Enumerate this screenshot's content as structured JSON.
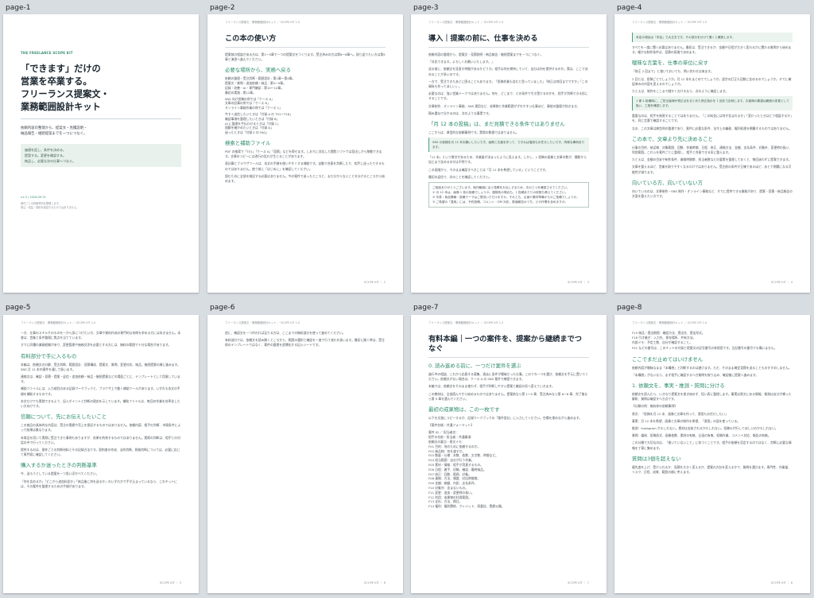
{
  "pages": {
    "p1": {
      "label": "page-1",
      "kit": "THE FREELANCE SCOPE KIT",
      "title": [
        "「できます」だけの",
        "営業を卒業する。",
        "フリーランス提案文・",
        "業務範囲設計キット"
      ],
      "subtitle": [
        "依頼内容の整理から、提案文・見積説明・",
        "納品報告・継続提案までを一つにつなぐ。"
      ],
      "box": [
        "価値を話し、条件を決める。",
        "提案する。変更を確認する。",
        "納品し、必要な次の仕事へつなぐ。"
      ],
      "version": "v1.0 | 2026.09.21",
      "notes": [
        "案件ごとの判断材料を整理します。",
        "受注・収益・契約を保証するものではありません。"
      ]
    },
    "p2": {
      "label": "page-2",
      "header": "フリーランス提案文・業務範囲設計キット ／ SCOPE KIT 1.0",
      "title": "この本の使い方",
      "intro": "提案前の相談がある方は、第1〜5章で一つの提案文をつくります。受注済みの方は第6〜8章へ。振り返りたい方は第9章と演習へ進んでください。",
      "s1": "必要な場所から、実務へ戻る",
      "list": [
        "依頼の整理・受注判断・範囲設計 : 第1章〜第4章。",
        "提案文・質問・追加依頼・納品 : 第5〜9章。",
        "記録・改善・AI・専門確認 : 第10〜12章。",
        "最初の実践 : 第12章。"
      ],
      "para1": "SNS 向け投稿の例では「ケース A」",
      "para2": "文章の記事の例では「ケース B」",
      "para3": "オンライン事務作業の例では「ケース C」",
      "para4": "今すぐ送信したいときは「付録 A の T01〜T18」",
      "para5": "確認事項を整理したいときは「付録 B」",
      "para6": "AI に整理を手伝わせるときは「付録 C」",
      "para7": "理解を確かめたいときは「付録 D」",
      "para8": "迷ったときは「付録 E の FAQ」",
      "s2": "検索と補助ファイル",
      "para9": "PDF の検索で「T01」「ケース A」「見積」などを探せます。しおりに対応した閲覧ソフトでは見出しから移動できます。文章のコピーには改行の乱れが生じることがあります。",
      "para10": "表計算とブラウザツールは、本文の手順を使いやすくする補助です。自動で合意を判断したり、相手に送ったりするものではありません。使う前に「はじめに」を確認してください。",
      "para11": "読むために全部を暗記する必要はありません。今の案件で迷ったところと、まだ分からないことを分けるところから始めます。",
      "footer": "SCOPE KIT ｜ 2"
    },
    "p3": {
      "label": "page-3",
      "header": "フリーランス提案文・業務範囲設計キット ／ SCOPE KIT 1.0",
      "title": "導入｜提案の前に、仕事を決める",
      "p1": "依頼内容の整理から、提案文・見積説明・納品報告・継続提案までを一つにつなぐ。",
      "p2": "「対応できます。よろしくお願いいたします。」",
      "p3": "送る前に、依頼文を見直す時間があるかどうか。相手は何を期待していて、自分は何を提供するのか。実は、ここで決めることが多いのです。",
      "p4": "一方で、受注できたあとに困ることもあります。「投稿作業も含むと思っていました」「修正は何回までですか」「この資料も作ってほしい」。",
      "p5": "必要なのは、強い営業トークではありません。何を、どこまで、どの条件で引き受けるのかを、相手が判断できる形にすることです。",
      "p6": "文章制作、オンライン事務、SNS 運用など、成果物と作業範囲がずれやすい仕事ほど、事前の整理が効きます。",
      "p7": "積み重ねで分かるのは、次のような事実です。",
      "s1": "「月 12 本の投稿」は、まだ見積できる条件ではありません",
      "p8": "ここからは、典型的な依頼事例です。実際の数値ではありません。",
      "callout": "SNS の投稿を月 12 本お願いしたいです。画像と文章を作って、できれば運用もお任せしたいです。同様な事例あります。",
      "p9": "「12 本」という数字があるため、作業量が決まったように見えます。しかし、1 投稿の画像と文章の数が、撮影から加工まで含めるのかは不明です。",
      "p10": "この段階から、そのまま確認すべきことは「月 12 本を希望している」ということです。",
      "p11": "最初の返信で、次のことを確認してください。",
      "box": [
        "ご相談ありがとうございます。制作範囲に合う見積をお出しするため、次の三つを確認させてください。",
        "① 月 12 本は、画像 1 枚の投稿でしょうか。複数枚の場合も、1 投稿あたりの枚数も教えてください。",
        "② 写真・商品情報・投稿テーマはご提供いただけますか。それとも、企画や素材準備からのご依頼でしょうか。",
        "③ ご希望の「運用」には、予約投稿、コメント・DM 対応、数値報告のうち、どの作業を含めますか。"
      ],
      "footer": "SCOPE KIT ｜ 3"
    },
    "p4": {
      "label": "page-4",
      "header": "フリーランス提案文・業務範囲設計キット ／ SCOPE KIT 1.0",
      "callout0": "本定の項目は「本定」で大丈夫です。その部分を分けて書くと確認します。",
      "p1": "すべてを一度に聞く必要はありません。最初は、受注できるか、金額や日程が大きく変わるかに関わる質問から始めます。細かな制作条件は、見積の段階で決めます。",
      "s1": "曖昧な言葉を、仕事の単位に戻す",
      "p2": "「修正 2 回まで」と書いておいても、問い合わせは来ます。",
      "p3": "2 回とは、投稿ごとでしょうか。月 12 本をまとめてでしょうか。誤字の訂正も回数に含めるのでしょうか。すでに確認済みの内容を変えるのでしょうか。",
      "p4": "たとえば、制作をここまで細かく分けるなら、次のように確認します。",
      "box": "1 便 4 投稿時に、ご担当者様が修正点をまとめた修正指示を 1 回まで反映します。お客様の要望は範囲の変更として扱い、工程を確認します。",
      "p5": "重要なのは、相手を制限することではありません。「この料金には何が含まれるか」「変わったときはどう相談するか」を、同じ言葉で確認することです。",
      "p6": "なお、この文章は典型例の整理であり、案件に必要な条件、法令上の義務、権利処理を網羅するものではありません。",
      "s2": "この本で、文章より先に決めること",
      "p7": "仕事の目的、納品物、対象範囲、回数、作業時間、日程、修正、連絡方法、金額、支払条件、対象外、変更時の扱い、利用範囲。これらを案件ごとに整理し、相手と合意できる形に整えます。",
      "p8": "たとえば、金額の目安や制作条件、業務時間帯、担当者数などの要素を整理しておくと、毎回迷わずに提案できます。",
      "p9": "文章を整えるほど、営業を取りやすくなるわけではありません。受注前の条件が正確であるほど、あとで問題になる可能性が減ります。",
      "s3": "向いている方、向いていない方",
      "p10": "向いているのは、文章制作・SNS 制作・オンライン事務など、すでに提供できる業務があり、提案・見積・納品報告の文面を整えたい方です。",
      "footer": "SCOPE KIT ｜ 4"
    },
    "p5": {
      "label": "page-5",
      "header": "フリーランス提案文・業務範囲設計キット ／ SCOPE KIT 1.0",
      "p1": "一方、仕事のスキルそのものを一から身につけたい方、文章や資料作成の専門的な技術を求める方には向きません。本書は、営業と条件整理に焦点を当てています。",
      "p2": "すでに同種の業務経験があり、変更管理や価格交渉を必要とする方には、無料の範囲で十分な場合があります。",
      "s1": "有料部分で手に入るもの",
      "p3": "本編は、依頼文の分解、受注判断、範囲設計、見積構成、提案文、質問、変更対応、納品、継続提案の順に進みます。SNS 月 12 本の案件を通して扱います。",
      "p4": "連絡文は、確認・見積・提案・返信・追加依頼・納品・継続提案などの場面ごとに、テンプレートとして用意しています。",
      "p5": "補助ファイルには、入力項目のある記録ワークブックと、ブラウザ上で動く補助ツールがあります。いずれも本文の手順を補助するものです。",
      "p6": "本文だけでも実践できるよう、記入ポイントと判断の理由を示しています。補助ファイルは、毎回の作業を効率化したい方向けです。",
      "s2": "信頼について、先にお伝えしたいこと",
      "p7": "この商品の具体的な内容は、受注の実績や売上を保証するものではありません。依頼内容、相手の判断、市場条件によって結果は異なります。",
      "p8": "本商品を用いて実際に受注できた事例もありますが、効果を約束するものではありません。実際の判断は、相手との対話の中で行ってください。",
      "p9": "提供するのは、案件ごとの判断材料とその記録方法です。契約書の作成、法的判断、税務判断については、必要に応じて専門家に確認してください。",
      "s3": "購入するか迷ったときの判断基準",
      "p10": "今、送ろうとしている提案を一つ思い浮かべてください。",
      "p11": "「何を含めるか」「どこから追加料金か」「納品後に何を送るか」のいずれかで手が止まっているなら、このキットには、その案件を整理するための手順があります。",
      "footer": "SCOPE KIT ｜ 5"
    },
    "p6": {
      "label": "page-6",
      "header": "フリーランス提案文・業務範囲設計キット ／ SCOPE KIT 1.0",
      "p1": "逆に、確認文を一つ作れれば足りる方は、ここまでの無料部分を使って進めてください。",
      "p2": "有料部分では、依頼文を読み解くところから、範囲の選択と確認を一度で行う流れを扱います。最初に開く時は、受注前のテンプレートではなく、案件の整理を習慣化する記入シートです。",
      "footer": "SCOPE KIT ｜ 6"
    },
    "p7": {
      "label": "page-7",
      "header": "フリーランス提案文・業務範囲設計キット ／ SCOPE KIT 1.0",
      "title": "有料本編｜一つの案件を、提案から継続までつなぐ",
      "s1": "0. 読み進める前に、一つだけ案件を選ぶ",
      "p1": "進行中の相談、これから応募する募集、過去に条件が曖昧だった仕事。このうち一つを選び、依頼文を手元に置いてください。依頼文がない場合は、ケース A の SNS 案件で練習できます。",
      "p2": "本編では、依頼文をそのまま使わず、相手が判断しやすい提案と確認の形へ変えていきます。",
      "p3": "この教材は、全部読んでから始めるものではありません。提案前なら第 1〜5 章、受注済みなら第 6〜8 章、完了後なら第 9 章を選んでください。",
      "s2": "最初の成果物は、この一枚です",
      "p4": "以下を文書にコピーするか、記録ワークブックの「案件設計」に入力してください。空欄を埋めながら進めます。",
      "p5": "【案件台帳・共通フォーマット】",
      "list": [
        "案件 ID ／ 担当者名：",
        "相手の名前・担当者・共通事項：",
        "依頼文の要点・原文メモ：",
        "F01 目的：何のために依頼するのか。",
        "F02 納品物：何を渡すか。",
        "F03 数量・仕様：本数、枚数、文字数、時間など。",
        "F04 担当範囲：自分が行う作業。",
        "F05 素材・情報：相手が用意するもの。",
        "F06 日程：着手、初稿、確認、最終納品。",
        "F07 修正：回数、範囲、対象。",
        "F08 連絡：方法、頻度、対応時間帯。",
        "F09 金額：総額、内訳、支払条件。",
        "F10 対象外：含まないもの。",
        "F11 変更：追加・変更時の扱い。",
        "F12 利用：成果物の利用範囲。",
        "F13 支払：方法、期日。",
        "F14 権利：権利関係、クレジット、再委託、実績公開。"
      ],
      "footer": "SCOPE KIT ｜ 7"
    },
    "p8": {
      "label": "page-8",
      "header": "フリーランス提案文・業務範囲設計キット ／ SCOPE KIT 1.0",
      "p1": "F15 納品・提出期限：確認方法、提出先、提出形式。",
      "p2": "F16 引き継ぎ：入力先、保存場所、共有方法。",
      "p3": "内部メモ：予定工数、自分が確認すること。",
      "p4": "F01 などの番号は、このキットの付録と提案文の記号番号の参照用です。注記番号の番号でも構いません。",
      "s1": "ここでまだ止めてはいけません",
      "p5": "依頼内容が曖昧なまま「本構想」と判断するのは避けます。ただ、そのまま確定見積を送ることもおすすめしません。",
      "p6": "「本構想」がないなら、まず相手に確認するべき質問を絞り込み、確認後に提案へ進みます。",
      "s2": "1. 依頼文を、事実・推測・質問に分ける",
      "p7": "依頼文を読んだら、いきなり提案文を書き始めず、短い表に整理します。事実は原文にある情報、推測は自分が補った解釈、質問は確認すべき点です。",
      "p8": "【分解の例：無料枠の依頼事例】",
      "p9": "原文：「投稿を月 12 本、画像と文章を作って、運用もお任せしたい」",
      "p10": "事実：月 12 本を希望、画像と文章の制作を希望。「運用」の語を使っている。",
      "p11": "推測：Instagram かもしれない。素材は支給されるかもしれない。投稿も代行してほしいのかもしれない。",
      "p12": "質問：媒体、投稿形式、画像枚数、素材の有無、企画の有無、投稿作業、コメント対応、報告の有無。",
      "p13": "この分類で大切なのは、「書いていないこと」に気づくことです。相手の依頼を否定するのではなく、判断に必要な情報を丁寧に集めます。",
      "s3": "質問は3個を超えない",
      "p14": "優先度を上げ、受けられるか、見積を大きく変えるか、提案の方針を変えるかで、質問を選びます。専門性、作業量、リスク、日程、成果、範囲の順に考えます。",
      "footer": "SCOPE KIT ｜ 8"
    }
  }
}
